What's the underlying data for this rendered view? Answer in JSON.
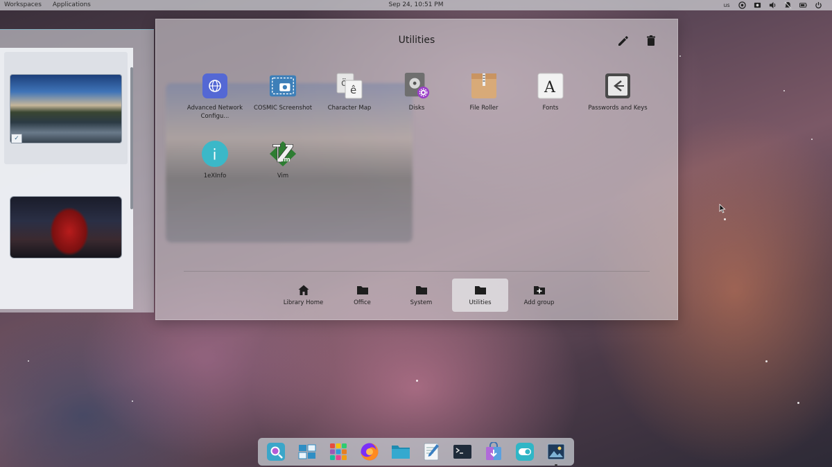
{
  "top_panel": {
    "workspaces": "Workspaces",
    "applications": "Applications",
    "clock": "Sep 24, 10:51 PM",
    "keyboard_layout": "us",
    "tray_icons": [
      "network-icon",
      "bluetooth-icon",
      "volume-icon",
      "notifications-icon",
      "battery-icon",
      "power-icon"
    ]
  },
  "workspaces_panel": {
    "items": [
      {
        "name": "workspace-1",
        "active": true,
        "thumbnail": "lake-landscape"
      },
      {
        "name": "workspace-2",
        "active": false,
        "thumbnail": "spider-man"
      }
    ]
  },
  "library": {
    "title": "Utilities",
    "actions": [
      "edit-icon",
      "delete-icon"
    ],
    "apps": [
      {
        "label": "Advanced Network Configu...",
        "icon": "network-config-icon"
      },
      {
        "label": "COSMIC Screenshot",
        "icon": "screenshot-icon"
      },
      {
        "label": "Character Map",
        "icon": "character-map-icon"
      },
      {
        "label": "Disks",
        "icon": "disks-icon"
      },
      {
        "label": "File Roller",
        "icon": "archive-icon"
      },
      {
        "label": "Fonts",
        "icon": "fonts-icon"
      },
      {
        "label": "Passwords and Keys",
        "icon": "keys-icon"
      },
      {
        "label": "1eXInfo",
        "icon": "info-icon"
      },
      {
        "label": "Vim",
        "icon": "vim-icon"
      }
    ],
    "groups": [
      {
        "label": "Library Home",
        "icon": "home-icon",
        "active": false
      },
      {
        "label": "Office",
        "icon": "folder-icon",
        "active": false
      },
      {
        "label": "System",
        "icon": "folder-icon",
        "active": false
      },
      {
        "label": "Utilities",
        "icon": "folder-icon",
        "active": true
      },
      {
        "label": "Add group",
        "icon": "add-folder-icon",
        "active": false
      }
    ]
  },
  "dock": {
    "items": [
      {
        "name": "launcher",
        "icon": "search-launcher-icon"
      },
      {
        "name": "workspaces",
        "icon": "workspaces-icon"
      },
      {
        "name": "app-library",
        "icon": "app-grid-icon"
      },
      {
        "name": "firefox",
        "icon": "firefox-icon"
      },
      {
        "name": "files",
        "icon": "files-icon"
      },
      {
        "name": "text-editor",
        "icon": "text-editor-icon"
      },
      {
        "name": "terminal",
        "icon": "terminal-icon"
      },
      {
        "name": "store",
        "icon": "store-icon"
      },
      {
        "name": "settings",
        "icon": "settings-icon"
      },
      {
        "name": "wallpaper",
        "icon": "image-viewer-icon",
        "running": true
      }
    ]
  },
  "colors": {
    "accent": "#2f8ec4",
    "panel": "#c8c8cd",
    "library_bg": "#d2cdd2"
  }
}
